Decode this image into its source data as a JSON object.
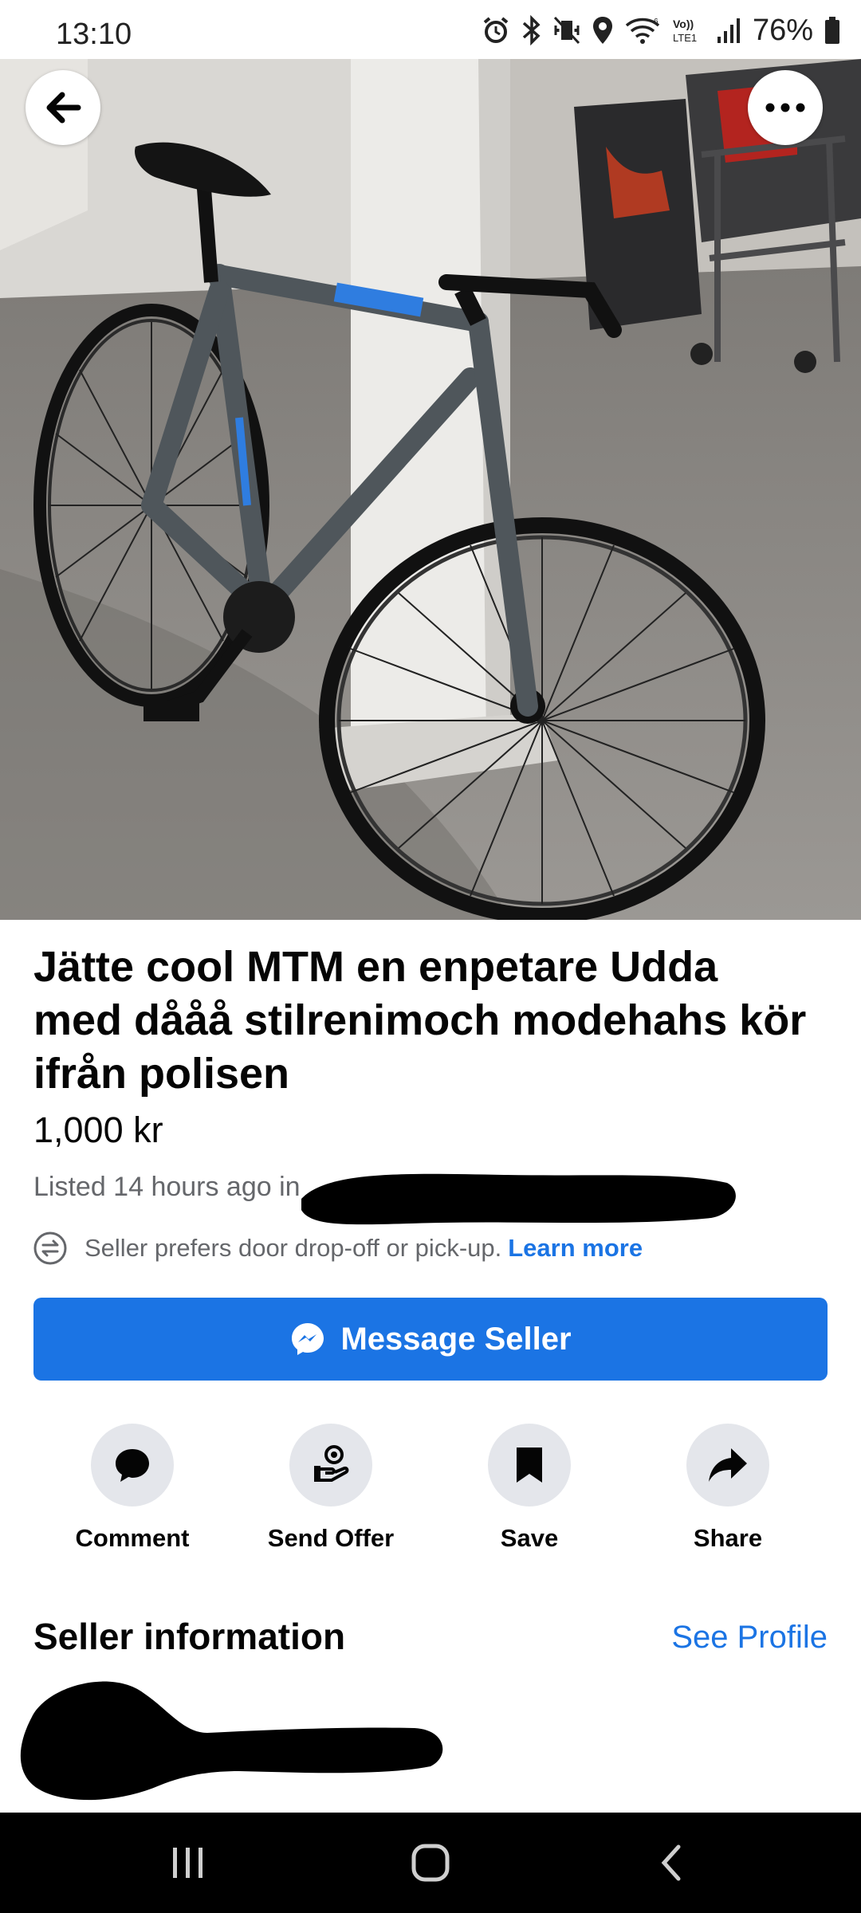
{
  "status_bar": {
    "time": "13:10",
    "battery": "76%",
    "icons": [
      "alarm-icon",
      "bluetooth-icon",
      "mute-icon",
      "location-icon",
      "wifi-icon",
      "volte-icon",
      "signal-icon",
      "battery-icon"
    ]
  },
  "listing": {
    "title": "Jätte cool MTM en enpetare Udda med dååå stilrenimoch modehahs kör ifrån polisen",
    "price": "1,000 kr",
    "listed": "Listed 14 hours ago in",
    "pickup_text": "Seller prefers door drop-off or pick-up.",
    "learn_more": "Learn more",
    "photo_count": 5,
    "photo_index": 0
  },
  "message_button": {
    "label": "Message Seller"
  },
  "actions": [
    {
      "label": "Comment",
      "icon": "comment-icon"
    },
    {
      "label": "Send Offer",
      "icon": "send-offer-icon"
    },
    {
      "label": "Save",
      "icon": "bookmark-icon"
    },
    {
      "label": "Share",
      "icon": "share-icon"
    }
  ],
  "seller": {
    "heading": "Seller information",
    "see_profile": "See Profile"
  },
  "colors": {
    "accent": "#1b74e4",
    "secondary_text": "#65676b",
    "action_bg": "#e4e6eb"
  }
}
